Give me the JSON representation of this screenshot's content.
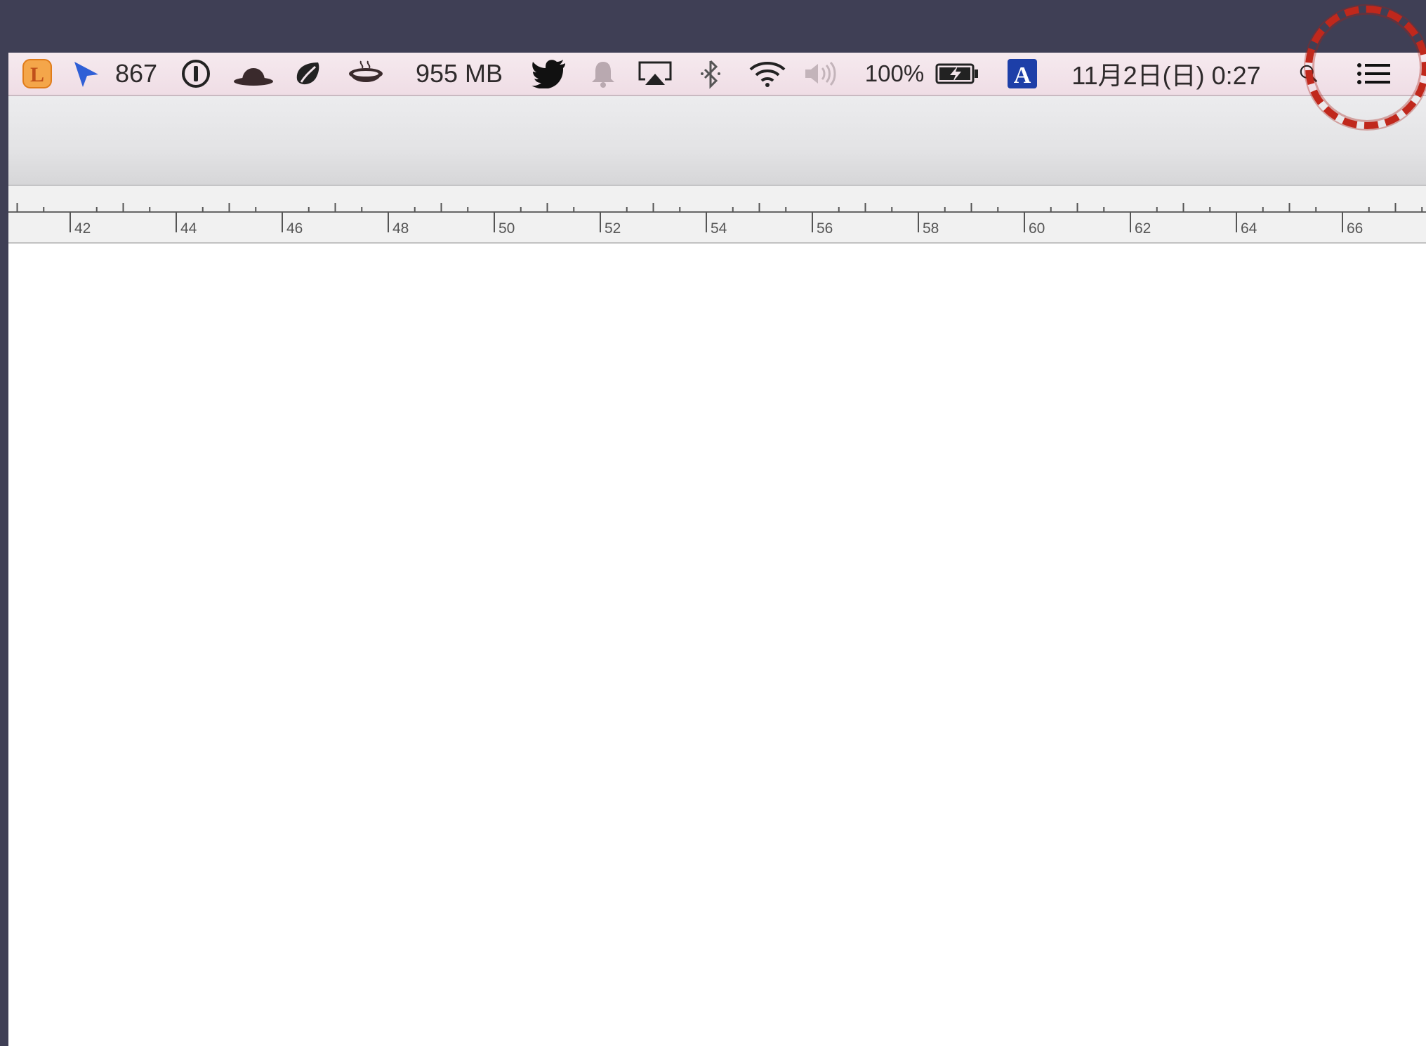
{
  "menubar": {
    "status_count": "867",
    "memory": "955 MB",
    "battery": "100%",
    "datetime": "11月2日(日) 0:27",
    "icons": [
      "l-app-icon",
      "send-arrow-icon",
      "onepassword-icon",
      "bowler-hat-icon",
      "evernote-leaf-icon",
      "coffee-cup-icon",
      "twitter-bird-icon",
      "notification-bell-icon",
      "airplay-icon",
      "bluetooth-icon",
      "wifi-icon",
      "volume-icon",
      "battery-charging-icon",
      "input-source-icon",
      "spotlight-icon",
      "notification-center-icon"
    ]
  },
  "ruler": {
    "labels": [
      "42",
      "44",
      "46",
      "48",
      "50",
      "52",
      "54",
      "56",
      "58",
      "60",
      "62",
      "64",
      "66"
    ]
  },
  "colors": {
    "desktop": "#3f3f55",
    "menubar": "#f3e4ea",
    "highlight": "#c0281c",
    "send_arrow": "#2f5fd6",
    "input_source": "#1d3fa8"
  }
}
